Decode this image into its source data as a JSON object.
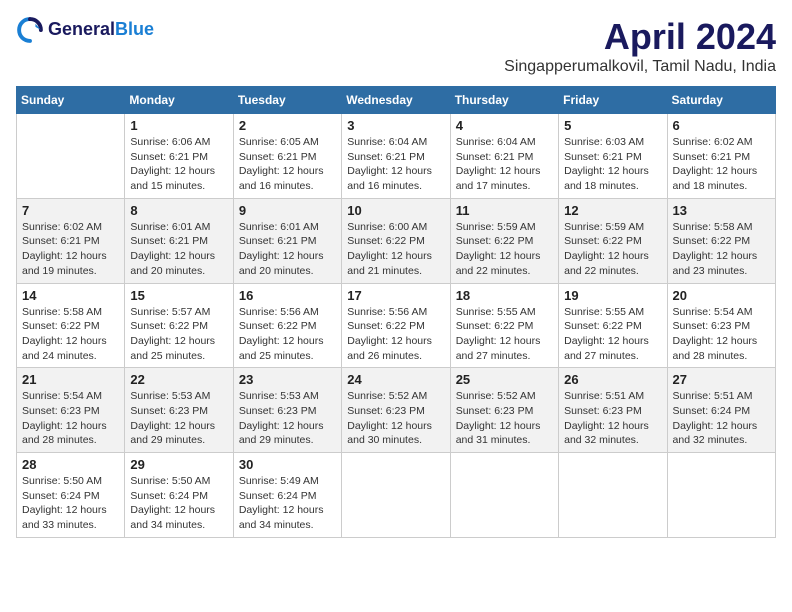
{
  "header": {
    "logo_line1": "General",
    "logo_line2": "Blue",
    "month_title": "April 2024",
    "location": "Singapperumalkovil, Tamil Nadu, India"
  },
  "columns": [
    "Sunday",
    "Monday",
    "Tuesday",
    "Wednesday",
    "Thursday",
    "Friday",
    "Saturday"
  ],
  "weeks": [
    [
      {
        "day": "",
        "info": ""
      },
      {
        "day": "1",
        "info": "Sunrise: 6:06 AM\nSunset: 6:21 PM\nDaylight: 12 hours\nand 15 minutes."
      },
      {
        "day": "2",
        "info": "Sunrise: 6:05 AM\nSunset: 6:21 PM\nDaylight: 12 hours\nand 16 minutes."
      },
      {
        "day": "3",
        "info": "Sunrise: 6:04 AM\nSunset: 6:21 PM\nDaylight: 12 hours\nand 16 minutes."
      },
      {
        "day": "4",
        "info": "Sunrise: 6:04 AM\nSunset: 6:21 PM\nDaylight: 12 hours\nand 17 minutes."
      },
      {
        "day": "5",
        "info": "Sunrise: 6:03 AM\nSunset: 6:21 PM\nDaylight: 12 hours\nand 18 minutes."
      },
      {
        "day": "6",
        "info": "Sunrise: 6:02 AM\nSunset: 6:21 PM\nDaylight: 12 hours\nand 18 minutes."
      }
    ],
    [
      {
        "day": "7",
        "info": "Sunrise: 6:02 AM\nSunset: 6:21 PM\nDaylight: 12 hours\nand 19 minutes."
      },
      {
        "day": "8",
        "info": "Sunrise: 6:01 AM\nSunset: 6:21 PM\nDaylight: 12 hours\nand 20 minutes."
      },
      {
        "day": "9",
        "info": "Sunrise: 6:01 AM\nSunset: 6:21 PM\nDaylight: 12 hours\nand 20 minutes."
      },
      {
        "day": "10",
        "info": "Sunrise: 6:00 AM\nSunset: 6:22 PM\nDaylight: 12 hours\nand 21 minutes."
      },
      {
        "day": "11",
        "info": "Sunrise: 5:59 AM\nSunset: 6:22 PM\nDaylight: 12 hours\nand 22 minutes."
      },
      {
        "day": "12",
        "info": "Sunrise: 5:59 AM\nSunset: 6:22 PM\nDaylight: 12 hours\nand 22 minutes."
      },
      {
        "day": "13",
        "info": "Sunrise: 5:58 AM\nSunset: 6:22 PM\nDaylight: 12 hours\nand 23 minutes."
      }
    ],
    [
      {
        "day": "14",
        "info": "Sunrise: 5:58 AM\nSunset: 6:22 PM\nDaylight: 12 hours\nand 24 minutes."
      },
      {
        "day": "15",
        "info": "Sunrise: 5:57 AM\nSunset: 6:22 PM\nDaylight: 12 hours\nand 25 minutes."
      },
      {
        "day": "16",
        "info": "Sunrise: 5:56 AM\nSunset: 6:22 PM\nDaylight: 12 hours\nand 25 minutes."
      },
      {
        "day": "17",
        "info": "Sunrise: 5:56 AM\nSunset: 6:22 PM\nDaylight: 12 hours\nand 26 minutes."
      },
      {
        "day": "18",
        "info": "Sunrise: 5:55 AM\nSunset: 6:22 PM\nDaylight: 12 hours\nand 27 minutes."
      },
      {
        "day": "19",
        "info": "Sunrise: 5:55 AM\nSunset: 6:22 PM\nDaylight: 12 hours\nand 27 minutes."
      },
      {
        "day": "20",
        "info": "Sunrise: 5:54 AM\nSunset: 6:23 PM\nDaylight: 12 hours\nand 28 minutes."
      }
    ],
    [
      {
        "day": "21",
        "info": "Sunrise: 5:54 AM\nSunset: 6:23 PM\nDaylight: 12 hours\nand 28 minutes."
      },
      {
        "day": "22",
        "info": "Sunrise: 5:53 AM\nSunset: 6:23 PM\nDaylight: 12 hours\nand 29 minutes."
      },
      {
        "day": "23",
        "info": "Sunrise: 5:53 AM\nSunset: 6:23 PM\nDaylight: 12 hours\nand 29 minutes."
      },
      {
        "day": "24",
        "info": "Sunrise: 5:52 AM\nSunset: 6:23 PM\nDaylight: 12 hours\nand 30 minutes."
      },
      {
        "day": "25",
        "info": "Sunrise: 5:52 AM\nSunset: 6:23 PM\nDaylight: 12 hours\nand 31 minutes."
      },
      {
        "day": "26",
        "info": "Sunrise: 5:51 AM\nSunset: 6:23 PM\nDaylight: 12 hours\nand 32 minutes."
      },
      {
        "day": "27",
        "info": "Sunrise: 5:51 AM\nSunset: 6:24 PM\nDaylight: 12 hours\nand 32 minutes."
      }
    ],
    [
      {
        "day": "28",
        "info": "Sunrise: 5:50 AM\nSunset: 6:24 PM\nDaylight: 12 hours\nand 33 minutes."
      },
      {
        "day": "29",
        "info": "Sunrise: 5:50 AM\nSunset: 6:24 PM\nDaylight: 12 hours\nand 34 minutes."
      },
      {
        "day": "30",
        "info": "Sunrise: 5:49 AM\nSunset: 6:24 PM\nDaylight: 12 hours\nand 34 minutes."
      },
      {
        "day": "",
        "info": ""
      },
      {
        "day": "",
        "info": ""
      },
      {
        "day": "",
        "info": ""
      },
      {
        "day": "",
        "info": ""
      }
    ]
  ]
}
